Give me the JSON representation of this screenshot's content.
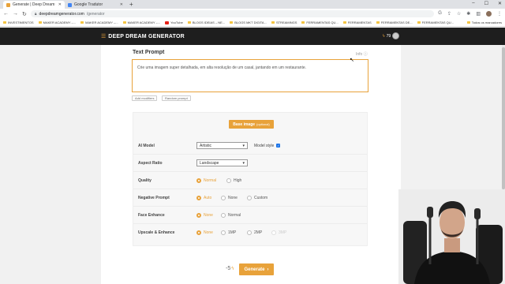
{
  "browser": {
    "tabs": [
      {
        "title": "Generate | Deep Dream Generator",
        "favicon_color": "#e8a23a",
        "active": true
      },
      {
        "title": "Google Tradutor",
        "favicon_color": "#4285f4",
        "active": false
      }
    ],
    "url_host": "deepdreamgenerator.com",
    "url_path": "/generator",
    "bookmarks": [
      {
        "label": "INVESTIMENTOS",
        "icon": "folder-icon"
      },
      {
        "label": "MAKER ACADEMY –...",
        "icon": "folder-icon"
      },
      {
        "label": "MAKER ACADEMY –...",
        "icon": "folder-icon"
      },
      {
        "label": "MAKER ACADEMY –...",
        "icon": "folder-icon"
      },
      {
        "label": "YouTube",
        "icon": "youtube-icon"
      },
      {
        "label": "BLOGS IDEIAS – NE...",
        "icon": "folder-icon"
      },
      {
        "label": "BLOGS MKT DIGITA...",
        "icon": "folder-icon"
      },
      {
        "label": "STREAMINGS",
        "icon": "folder-icon"
      },
      {
        "label": "FERRAMENTAS QU...",
        "icon": "folder-icon"
      },
      {
        "label": "FERRAMENTAS",
        "icon": "folder-icon"
      },
      {
        "label": "FERRAMENTAS DE...",
        "icon": "folder-icon"
      },
      {
        "label": "FERRAMENTAS QU...",
        "icon": "folder-icon"
      }
    ],
    "all_bookmarks": "Todos os marcadores"
  },
  "site": {
    "logo": "DEEP DREAM GENERATOR",
    "credits": "79",
    "accent": "#e8a23a"
  },
  "form": {
    "text_prompt_label": "Text Prompt",
    "info_label": "Info",
    "prompt_value": "Crie uma imagem super detalhada, em alta resolução de um casal, jantando em um restaurante.",
    "add_modifiers": "Add modifiers",
    "random_prompt": "Random prompt",
    "base_image": "Base image",
    "base_image_optional": "(optional)",
    "ai_model_label": "AI Model",
    "ai_model_value": "Artistic",
    "model_style_label": "Model style",
    "aspect_ratio_label": "Aspect Ratio",
    "aspect_ratio_value": "Landscape",
    "quality_label": "Quality",
    "quality_options": [
      "Normal",
      "High"
    ],
    "negative_prompt_label": "Negative Prompt",
    "negative_options": [
      "Auto",
      "None",
      "Custom"
    ],
    "face_enhance_label": "Face Enhance",
    "face_options": [
      "None",
      "Normal"
    ],
    "upscale_label": "Upscale & Enhance",
    "upscale_options": [
      "None",
      "1MP",
      "2MP",
      "3MP"
    ],
    "cost": "-5",
    "generate": "Generate"
  }
}
